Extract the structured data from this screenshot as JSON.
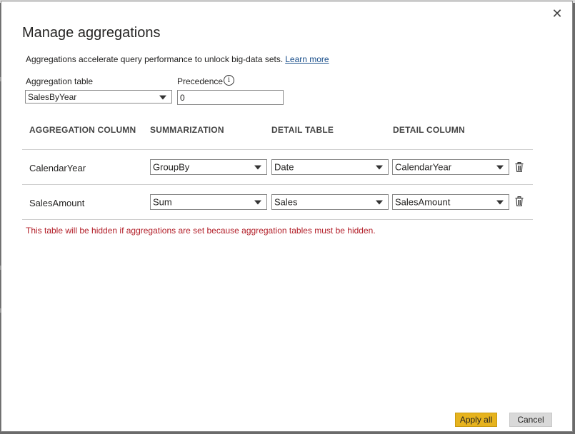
{
  "dialog": {
    "title": "Manage aggregations",
    "description": "Aggregations accelerate query performance to unlock big-data sets.",
    "learn_more": "Learn more",
    "close_icon": "close-icon",
    "aggregation_table_label": "Aggregation table",
    "aggregation_table_value": "SalesByYear",
    "precedence_label": "Precedence",
    "precedence_info_icon": "info-icon",
    "precedence_value": "0",
    "columns": [
      "AGGREGATION COLUMN",
      "SUMMARIZATION",
      "DETAIL TABLE",
      "DETAIL COLUMN"
    ],
    "rows": [
      {
        "aggregation_column": "CalendarYear",
        "summarization": "GroupBy",
        "detail_table": "Date",
        "detail_column": "CalendarYear"
      },
      {
        "aggregation_column": "SalesAmount",
        "summarization": "Sum",
        "detail_table": "Sales",
        "detail_column": "SalesAmount"
      }
    ],
    "warning": "This table will be hidden if aggregations are set because aggregation tables must be hidden.",
    "apply_label": "Apply all",
    "cancel_label": "Cancel"
  },
  "colors": {
    "accent": "#e6b31e",
    "warning": "#b3202a",
    "link": "#1a4f8b"
  }
}
